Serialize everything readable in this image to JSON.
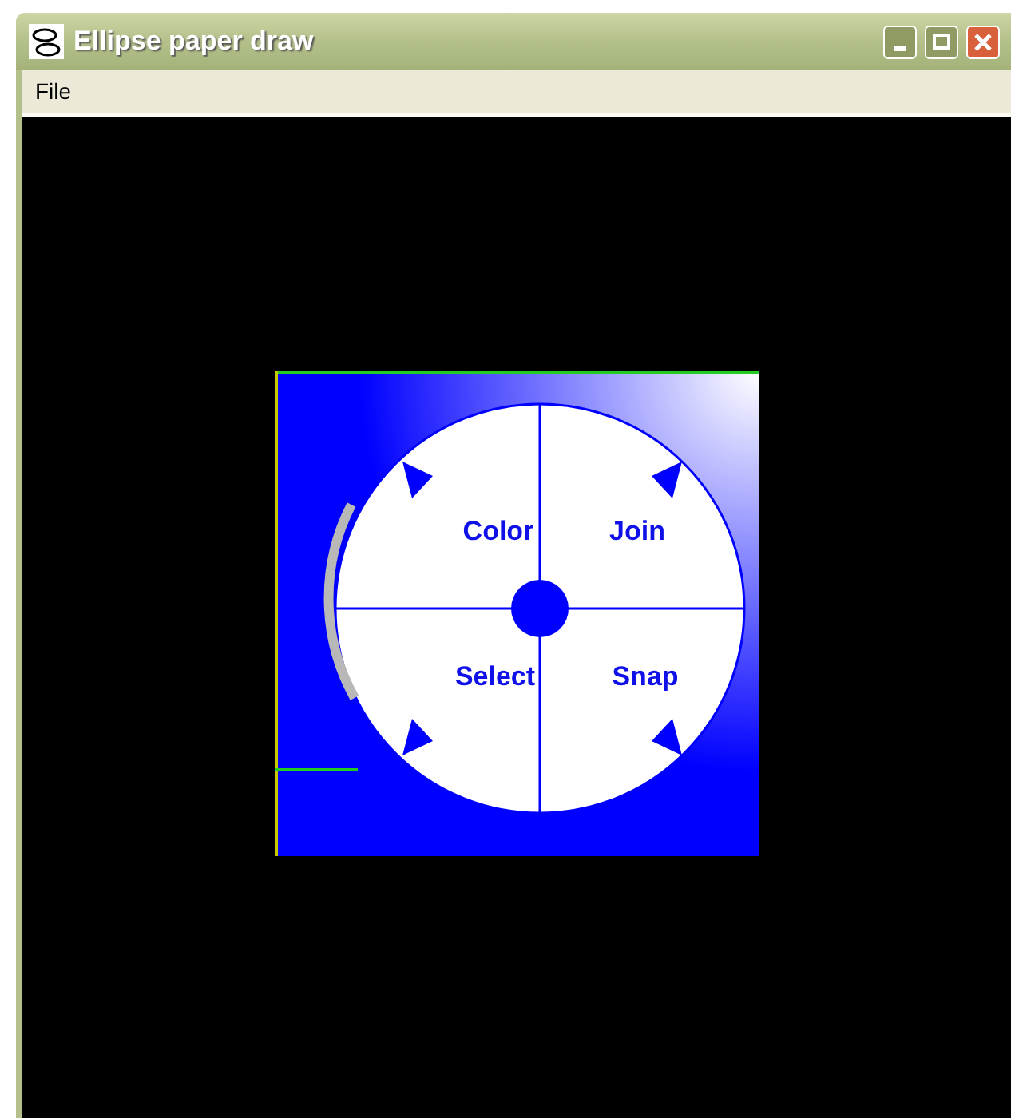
{
  "window": {
    "title": "Ellipse paper draw"
  },
  "menu": [
    {
      "label": "File"
    }
  ],
  "pie_menu": {
    "items": [
      {
        "label": "Color"
      },
      {
        "label": "Join"
      },
      {
        "label": "Select"
      },
      {
        "label": "Snap"
      }
    ]
  }
}
